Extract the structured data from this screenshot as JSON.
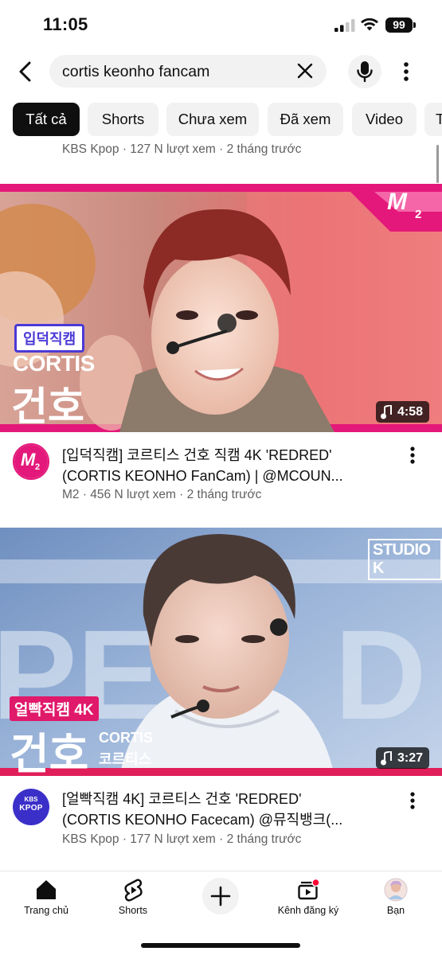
{
  "status_bar": {
    "time": "11:05",
    "battery": "99"
  },
  "search": {
    "query": "cortis keonho fancam"
  },
  "chips": [
    "Tất cả",
    "Shorts",
    "Chưa xem",
    "Đã xem",
    "Video",
    "T"
  ],
  "previous_video": {
    "meta": "KBS Kpop · 127 N lượt xem · 2 tháng trước"
  },
  "videos": [
    {
      "thumb_brand": "M",
      "thumb_brand_sub": "2",
      "thumb_tag": "입덕직캠",
      "thumb_group": "CORTIS",
      "thumb_name": "건호",
      "duration": "4:58",
      "title_line1": "[입덕직캠] 코르티스 건호 직캠 4K 'REDRED'",
      "title_line2": "(CORTIS KEONHO FanCam) | @MCOUN...",
      "meta": "M2 · 456 N lượt xem · 2 tháng trước",
      "avatar_text": "M",
      "avatar_sub": "2"
    },
    {
      "thumb_brand": "STUDIO K",
      "thumb_tag": "얼빡직캠 4K",
      "thumb_group": "CORTIS",
      "thumb_group_kr": "코르티스",
      "thumb_name": "건호",
      "duration": "3:27",
      "title_line1": "[얼빡직캠 4K] 코르티스 건호 'REDRED'",
      "title_line2": "(CORTIS KEONHO Facecam) @뮤직뱅크(...",
      "meta": "KBS Kpop · 177 N lượt xem · 2 tháng trước",
      "avatar_text": "KBS",
      "avatar_sub": "KPOP"
    }
  ],
  "bottom_nav": {
    "home": "Trang chủ",
    "shorts": "Shorts",
    "subscriptions": "Kênh đăng ký",
    "you": "Bạn"
  },
  "colors": {
    "accent": "#ff0033",
    "m2_pink": "#e4187a",
    "kbs_purple": "#3b2fc9"
  }
}
